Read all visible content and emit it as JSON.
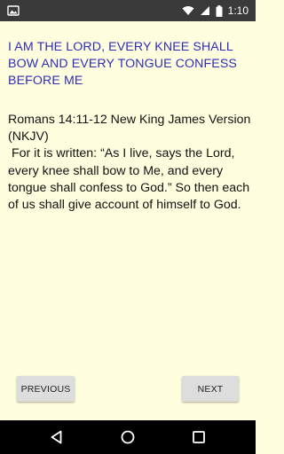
{
  "status_bar": {
    "time": "1:10",
    "icons": [
      "photo-icon",
      "wifi-icon",
      "signal-icon",
      "battery-icon"
    ]
  },
  "verse": {
    "title": "I AM THE LORD, EVERY KNEE SHALL BOW AND EVERY TONGUE CONFESS BEFORE ME",
    "reference": "Romans 14:11-12 New King James Version (NKJV)",
    "text": " For it is written: “As I live, says the Lord, every knee shall bow to Me, and every tongue shall confess to God.” So then each of us shall give account of himself to God."
  },
  "buttons": {
    "previous": "PREVIOUS",
    "next": "NEXT"
  },
  "nav_bar": {
    "icons": [
      "back-icon",
      "home-icon",
      "recents-icon"
    ]
  },
  "colors": {
    "background": "#FFFFE0",
    "title": "#2D2DB8",
    "status_bar": "#3A3A3A",
    "nav_bar": "#000000"
  }
}
